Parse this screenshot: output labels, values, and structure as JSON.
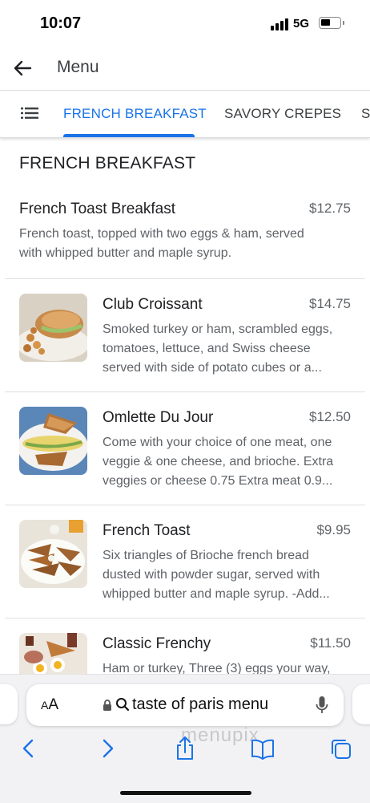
{
  "status_bar": {
    "time": "10:07",
    "network": "5G"
  },
  "header": {
    "back_icon": "arrow-left-icon",
    "title": "Menu"
  },
  "tabs": {
    "menu_icon": "list-icon",
    "items": [
      {
        "label": "FRENCH BREAKFAST",
        "active": true
      },
      {
        "label": "SAVORY CREPES",
        "active": false
      },
      {
        "label": "SW",
        "active": false
      }
    ],
    "active_color": "#1a73e8"
  },
  "section": {
    "title": "FRENCH BREAKFAST"
  },
  "menu_items": [
    {
      "name": "French Toast Breakfast",
      "price": "$12.75",
      "description_lines": [
        "French toast, topped with two eggs & ham, served",
        "with whipped butter and maple syrup."
      ]
    },
    {
      "name": "Club Croissant",
      "price": "$14.75",
      "description_lines": [
        "Smoked turkey or ham, scrambled eggs,",
        "tomatoes, lettuce, and Swiss cheese",
        "served with side of potato cubes or a..."
      ],
      "image": "croissant-sandwich-photo"
    },
    {
      "name": "Omlette Du Jour",
      "price": "$12.50",
      "description_lines": [
        "Come with your choice of one meat, one",
        "veggie & one cheese, and brioche. Extra",
        "veggies or cheese 0.75 Extra meat 0.9..."
      ],
      "image": "omelette-photo"
    },
    {
      "name": "French Toast",
      "price": "$9.95",
      "description_lines": [
        "Six triangles of Brioche french bread",
        "dusted with powder sugar, served with",
        "whipped butter and maple syrup. -Add..."
      ],
      "image": "french-toast-photo"
    },
    {
      "name": "Classic Frenchy",
      "price": "$11.50",
      "description_lines": [
        "Ham or turkey, Three (3) eggs your way,"
      ],
      "image": "classic-frenchy-photo"
    }
  ],
  "browser": {
    "aa_label_big": "A",
    "aa_label_small": "A",
    "address": "taste of paris menu",
    "watermark": "menupix",
    "icons": [
      "lock-icon",
      "search-icon",
      "microphone-icon",
      "back-chevron-icon",
      "forward-chevron-icon",
      "share-icon",
      "bookmarks-icon",
      "tabs-icon"
    ]
  }
}
